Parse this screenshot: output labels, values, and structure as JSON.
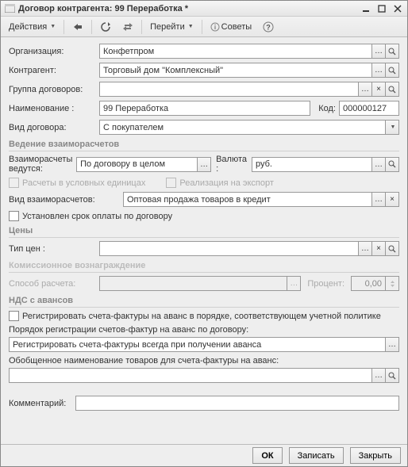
{
  "window": {
    "title": "Договор контрагента: 99 Переработка *"
  },
  "toolbar": {
    "actions": "Действия",
    "goto": "Перейти",
    "tips": "Советы"
  },
  "fields": {
    "org_label": "Организация:",
    "org_value": "Конфетпром",
    "partner_label": "Контрагент:",
    "partner_value": "Торговый дом \"Комплексный\"",
    "group_label": "Группа договоров:",
    "group_value": "",
    "name_label": "Наименование :",
    "name_value": "99 Переработка",
    "code_label": "Код:",
    "code_value": "000000127",
    "kind_label": "Вид договора:",
    "kind_value": "С покупателем"
  },
  "sections": {
    "settlements": "Ведение взаиморасчетов",
    "prices": "Цены",
    "commission": "Комиссионное вознаграждение",
    "vat": "НДС с авансов"
  },
  "settlements": {
    "by_label": "Взаиморасчеты ведутся:",
    "by_value": "По договору в целом",
    "currency_label": "Валюта :",
    "currency_value": "руб.",
    "cb_conditional": "Расчеты в условных единицах",
    "cb_export": "Реализация на экспорт",
    "kind_label": "Вид взаиморасчетов:",
    "kind_value": "Оптовая продажа товаров в кредит",
    "cb_deadline": "Установлен срок оплаты по договору"
  },
  "prices": {
    "type_label": "Тип цен :",
    "type_value": ""
  },
  "commission": {
    "method_label": "Способ расчета:",
    "method_value": "",
    "percent_label": "Процент:",
    "percent_value": "0,00"
  },
  "vat": {
    "cb_register": "Регистрировать счета-фактуры на аванс в порядке, соответствующем учетной политике",
    "order_label": "Порядок регистрации счетов-фактур на аванс по договору:",
    "order_value": "Регистрировать счета-фактуры всегда при получении аванса",
    "gen_name_label": "Обобщенное наименование товаров для счета-фактуры на аванс:",
    "gen_name_value": ""
  },
  "comment": {
    "label": "Комментарий:",
    "value": ""
  },
  "footer": {
    "ok": "ОК",
    "save": "Записать",
    "close": "Закрыть"
  }
}
